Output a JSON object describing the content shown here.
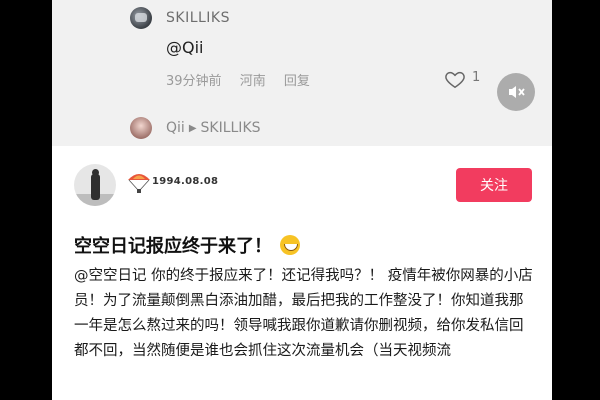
{
  "top_comment": {
    "username": "SKILLIKS",
    "text": "@Qii",
    "time": "39分钟前",
    "location": "河南",
    "reply_label": "回复",
    "like_count": "1",
    "icons": [
      "heart-icon",
      "mute-icon"
    ]
  },
  "reply_preview": {
    "from": "Qii",
    "to": "SKILLIKS"
  },
  "post": {
    "username": "1994.08.08",
    "follow_label": "关注",
    "title": "空空日记报应终于来了！",
    "body": "@空空日记 你的终于报应来了！还记得我吗？！ 疫情年被你网暴的小店员！为了流量颠倒黑白添油加醋，最后把我的工作整没了！你知道我那一年是怎么熬过来的吗！领导喊我跟你道歉请你删视频，给你发私信回都不回，当然随便是谁也会抓住这次流量机会（当天视频流",
    "accent_color": "#f23c5f"
  }
}
